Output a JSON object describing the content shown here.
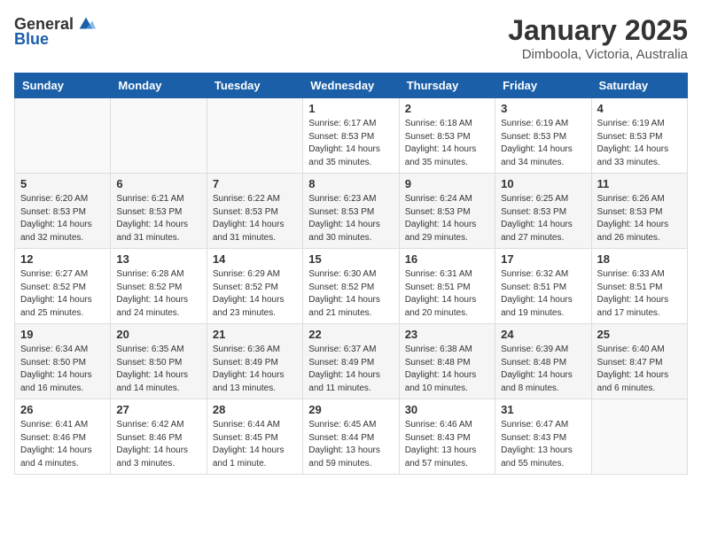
{
  "header": {
    "logo_general": "General",
    "logo_blue": "Blue",
    "month": "January 2025",
    "location": "Dimboola, Victoria, Australia"
  },
  "weekdays": [
    "Sunday",
    "Monday",
    "Tuesday",
    "Wednesday",
    "Thursday",
    "Friday",
    "Saturday"
  ],
  "weeks": [
    [
      {
        "day": "",
        "info": ""
      },
      {
        "day": "",
        "info": ""
      },
      {
        "day": "",
        "info": ""
      },
      {
        "day": "1",
        "info": "Sunrise: 6:17 AM\nSunset: 8:53 PM\nDaylight: 14 hours\nand 35 minutes."
      },
      {
        "day": "2",
        "info": "Sunrise: 6:18 AM\nSunset: 8:53 PM\nDaylight: 14 hours\nand 35 minutes."
      },
      {
        "day": "3",
        "info": "Sunrise: 6:19 AM\nSunset: 8:53 PM\nDaylight: 14 hours\nand 34 minutes."
      },
      {
        "day": "4",
        "info": "Sunrise: 6:19 AM\nSunset: 8:53 PM\nDaylight: 14 hours\nand 33 minutes."
      }
    ],
    [
      {
        "day": "5",
        "info": "Sunrise: 6:20 AM\nSunset: 8:53 PM\nDaylight: 14 hours\nand 32 minutes."
      },
      {
        "day": "6",
        "info": "Sunrise: 6:21 AM\nSunset: 8:53 PM\nDaylight: 14 hours\nand 31 minutes."
      },
      {
        "day": "7",
        "info": "Sunrise: 6:22 AM\nSunset: 8:53 PM\nDaylight: 14 hours\nand 31 minutes."
      },
      {
        "day": "8",
        "info": "Sunrise: 6:23 AM\nSunset: 8:53 PM\nDaylight: 14 hours\nand 30 minutes."
      },
      {
        "day": "9",
        "info": "Sunrise: 6:24 AM\nSunset: 8:53 PM\nDaylight: 14 hours\nand 29 minutes."
      },
      {
        "day": "10",
        "info": "Sunrise: 6:25 AM\nSunset: 8:53 PM\nDaylight: 14 hours\nand 27 minutes."
      },
      {
        "day": "11",
        "info": "Sunrise: 6:26 AM\nSunset: 8:53 PM\nDaylight: 14 hours\nand 26 minutes."
      }
    ],
    [
      {
        "day": "12",
        "info": "Sunrise: 6:27 AM\nSunset: 8:52 PM\nDaylight: 14 hours\nand 25 minutes."
      },
      {
        "day": "13",
        "info": "Sunrise: 6:28 AM\nSunset: 8:52 PM\nDaylight: 14 hours\nand 24 minutes."
      },
      {
        "day": "14",
        "info": "Sunrise: 6:29 AM\nSunset: 8:52 PM\nDaylight: 14 hours\nand 23 minutes."
      },
      {
        "day": "15",
        "info": "Sunrise: 6:30 AM\nSunset: 8:52 PM\nDaylight: 14 hours\nand 21 minutes."
      },
      {
        "day": "16",
        "info": "Sunrise: 6:31 AM\nSunset: 8:51 PM\nDaylight: 14 hours\nand 20 minutes."
      },
      {
        "day": "17",
        "info": "Sunrise: 6:32 AM\nSunset: 8:51 PM\nDaylight: 14 hours\nand 19 minutes."
      },
      {
        "day": "18",
        "info": "Sunrise: 6:33 AM\nSunset: 8:51 PM\nDaylight: 14 hours\nand 17 minutes."
      }
    ],
    [
      {
        "day": "19",
        "info": "Sunrise: 6:34 AM\nSunset: 8:50 PM\nDaylight: 14 hours\nand 16 minutes."
      },
      {
        "day": "20",
        "info": "Sunrise: 6:35 AM\nSunset: 8:50 PM\nDaylight: 14 hours\nand 14 minutes."
      },
      {
        "day": "21",
        "info": "Sunrise: 6:36 AM\nSunset: 8:49 PM\nDaylight: 14 hours\nand 13 minutes."
      },
      {
        "day": "22",
        "info": "Sunrise: 6:37 AM\nSunset: 8:49 PM\nDaylight: 14 hours\nand 11 minutes."
      },
      {
        "day": "23",
        "info": "Sunrise: 6:38 AM\nSunset: 8:48 PM\nDaylight: 14 hours\nand 10 minutes."
      },
      {
        "day": "24",
        "info": "Sunrise: 6:39 AM\nSunset: 8:48 PM\nDaylight: 14 hours\nand 8 minutes."
      },
      {
        "day": "25",
        "info": "Sunrise: 6:40 AM\nSunset: 8:47 PM\nDaylight: 14 hours\nand 6 minutes."
      }
    ],
    [
      {
        "day": "26",
        "info": "Sunrise: 6:41 AM\nSunset: 8:46 PM\nDaylight: 14 hours\nand 4 minutes."
      },
      {
        "day": "27",
        "info": "Sunrise: 6:42 AM\nSunset: 8:46 PM\nDaylight: 14 hours\nand 3 minutes."
      },
      {
        "day": "28",
        "info": "Sunrise: 6:44 AM\nSunset: 8:45 PM\nDaylight: 14 hours\nand 1 minute."
      },
      {
        "day": "29",
        "info": "Sunrise: 6:45 AM\nSunset: 8:44 PM\nDaylight: 13 hours\nand 59 minutes."
      },
      {
        "day": "30",
        "info": "Sunrise: 6:46 AM\nSunset: 8:43 PM\nDaylight: 13 hours\nand 57 minutes."
      },
      {
        "day": "31",
        "info": "Sunrise: 6:47 AM\nSunset: 8:43 PM\nDaylight: 13 hours\nand 55 minutes."
      },
      {
        "day": "",
        "info": ""
      }
    ]
  ]
}
